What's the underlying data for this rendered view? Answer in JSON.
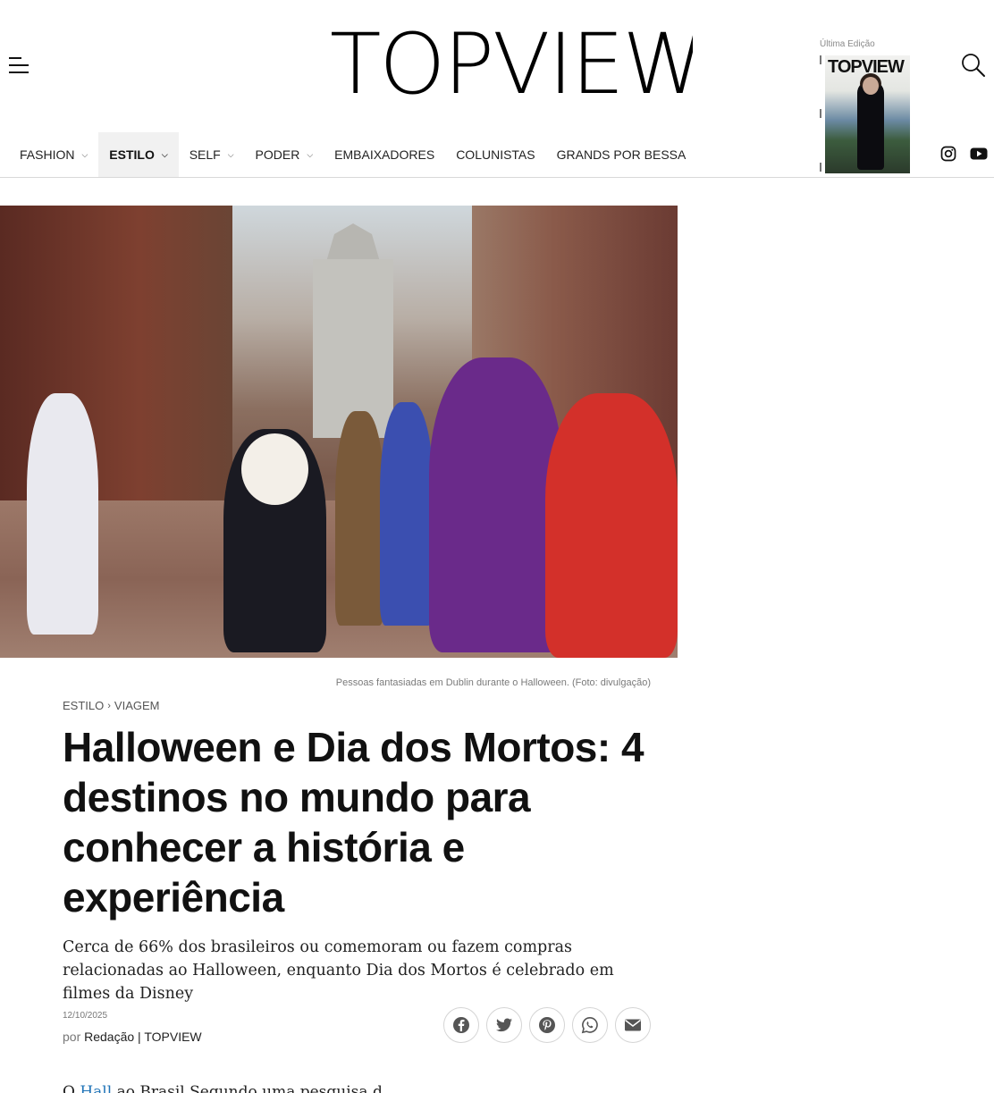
{
  "brand": {
    "logo_text": "TOPVIEW"
  },
  "header": {
    "edition_label": "Última Edição",
    "cover_logo": "TOPVIEW"
  },
  "nav": {
    "items": [
      {
        "label": "FASHION",
        "has_dropdown": true,
        "active": false
      },
      {
        "label": "ESTILO",
        "has_dropdown": true,
        "active": true
      },
      {
        "label": "SELF",
        "has_dropdown": true,
        "active": false
      },
      {
        "label": "PODER",
        "has_dropdown": true,
        "active": false
      },
      {
        "label": "EMBAIXADORES",
        "has_dropdown": false,
        "active": false
      },
      {
        "label": "COLUNISTAS",
        "has_dropdown": false,
        "active": false
      },
      {
        "label": "GRANDS POR BESSA",
        "has_dropdown": false,
        "active": false
      }
    ]
  },
  "social": {
    "icons": [
      "instagram-icon",
      "youtube-icon"
    ]
  },
  "article": {
    "image_caption": "Pessoas fantasiadas em Dublin durante o Halloween. (Foto: divulgação)",
    "breadcrumb": {
      "category": "ESTILO",
      "separator": "›",
      "subcategory": "VIAGEM"
    },
    "title": "Halloween e Dia dos Mortos: 4 destinos no mundo para conhecer a história e experiência",
    "subtitle": "Cerca de 66% dos brasileiros ou comemoram ou fazem compras relacionadas ao Halloween, enquanto Dia dos Mortos é celebrado em filmes da Disney",
    "date": "12/10/2025",
    "byline_prefix": "por",
    "author": "Redação | TOPVIEW",
    "share_icons": [
      "facebook-icon",
      "twitter-icon",
      "pinterest-icon",
      "whatsapp-icon",
      "email-icon"
    ],
    "body_start": "O",
    "body_link": "Hall",
    "body_rest": "                                 ao  Brasil  Segundo  uma  pesquisa  d"
  },
  "colors": {
    "accent_link": "#1f73b7",
    "text": "#111111",
    "muted": "#777777"
  }
}
